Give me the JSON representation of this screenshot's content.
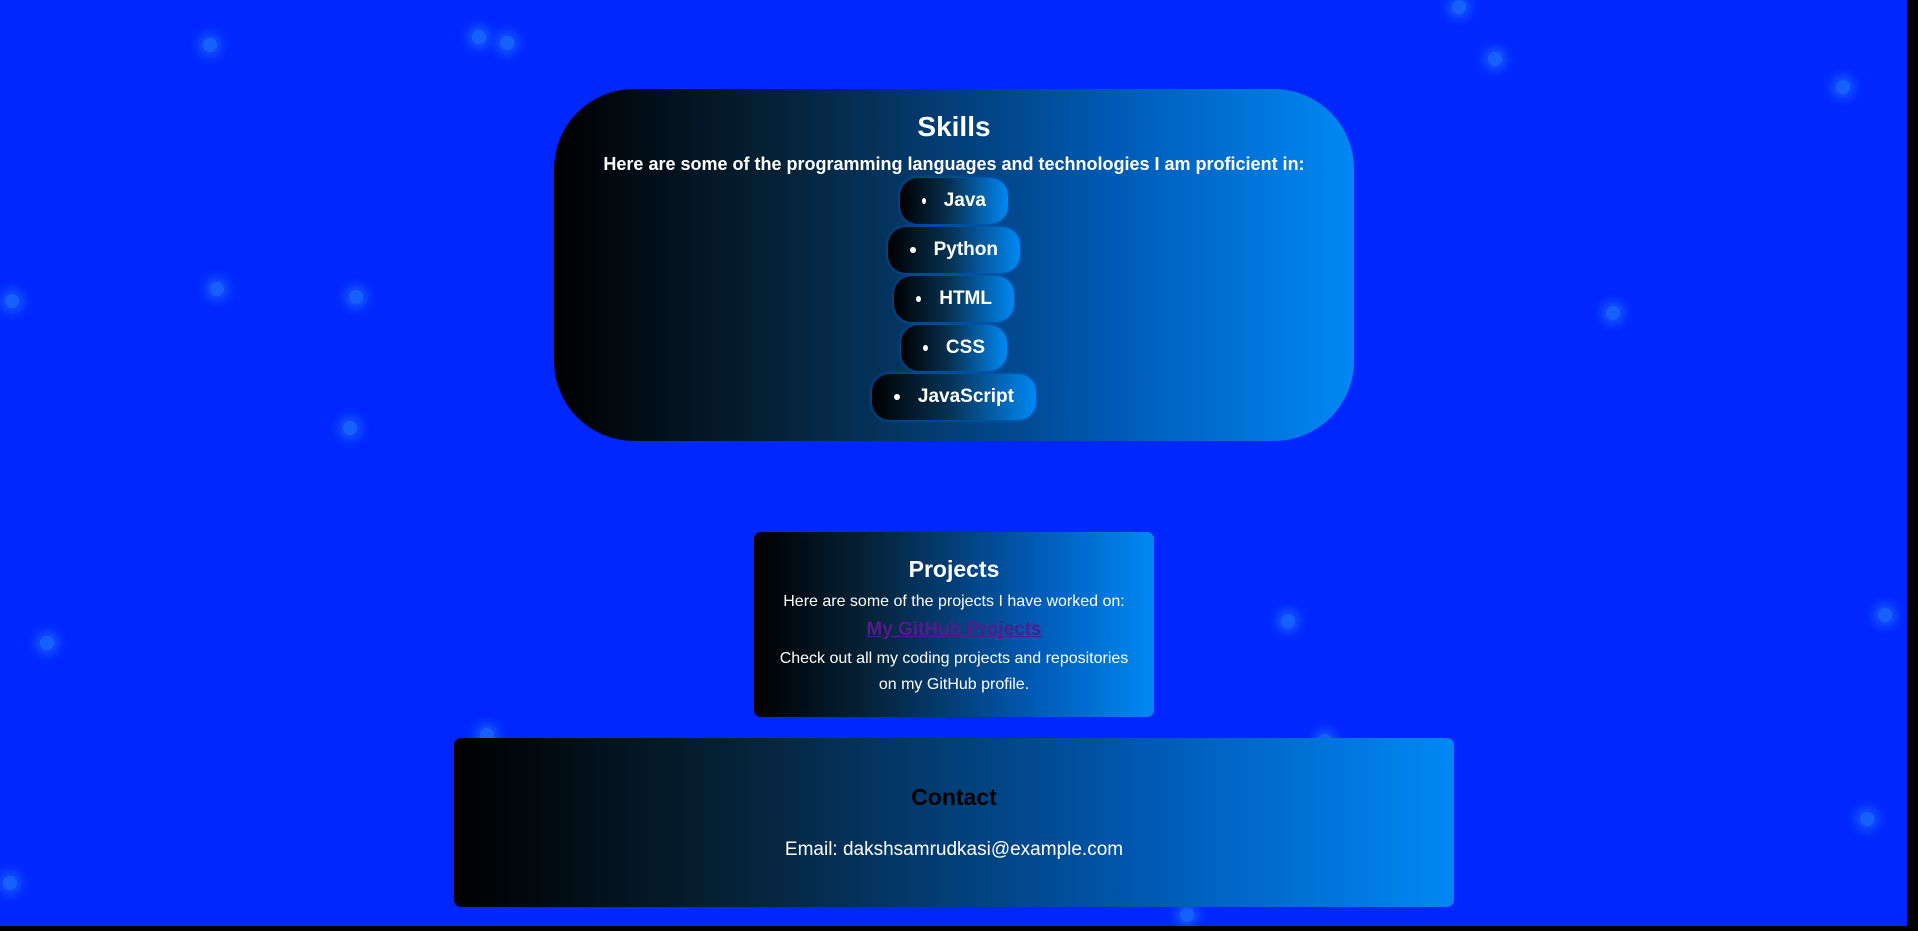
{
  "colors": {
    "page_background": "#0028fe",
    "card_gradient_start": "#000000",
    "card_gradient_end": "#0088f5",
    "link_color": "#551a8b"
  },
  "skills": {
    "title": "Skills",
    "intro": "Here are some of the programming languages and technologies I am proficient in:",
    "items": [
      "Java",
      "Python",
      "HTML",
      "CSS",
      "JavaScript"
    ]
  },
  "projects": {
    "title": "Projects",
    "intro": "Here are some of the projects I have worked on:",
    "link_label": "My GitHub Projects",
    "description": "Check out all my coding projects and repositories on my GitHub profile."
  },
  "contact": {
    "title": "Contact",
    "email": "Email: dakshsamrudkasi@example.com"
  }
}
